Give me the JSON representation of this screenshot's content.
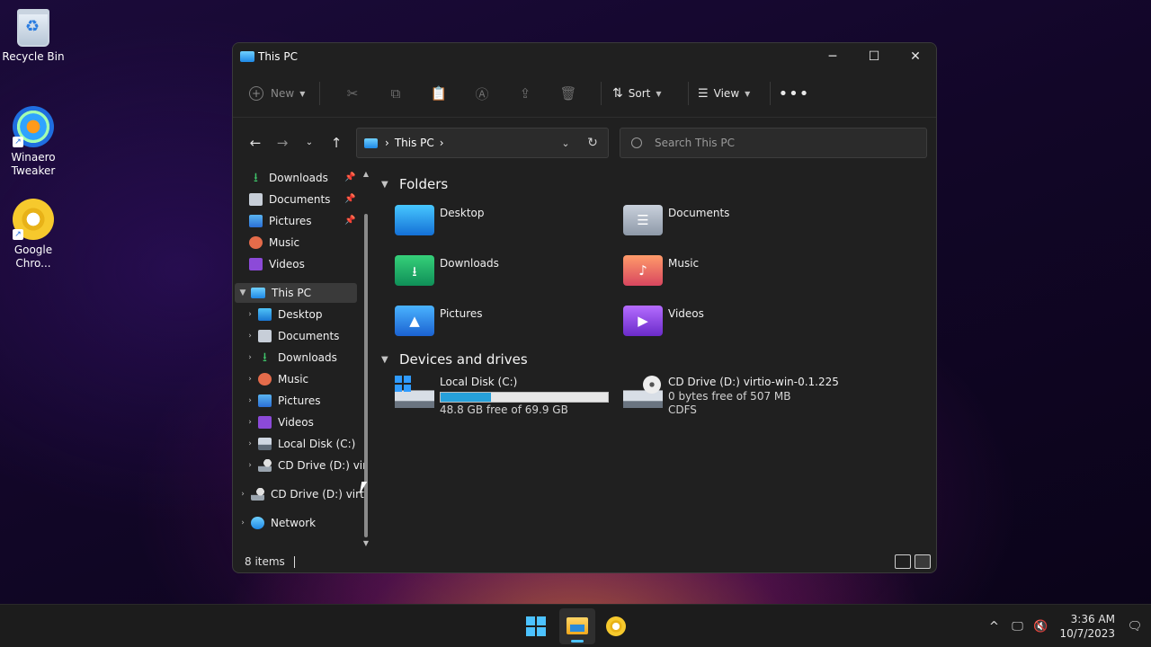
{
  "desktop": {
    "icons": [
      {
        "label": "Recycle Bin"
      },
      {
        "label": "Winaero\nTweaker"
      },
      {
        "label": "Google\nChro..."
      }
    ]
  },
  "window": {
    "title": "This PC",
    "controls": {
      "minimize": "─",
      "maximize": "☐",
      "close": "✕"
    }
  },
  "toolbar": {
    "new_label": "New",
    "sort_label": "Sort",
    "view_label": "View",
    "more_label": "•••"
  },
  "address": {
    "location": "This PC"
  },
  "search": {
    "placeholder": "Search This PC"
  },
  "sidebar": {
    "quick_access": [
      {
        "label": "Downloads",
        "icon": "download-icon"
      },
      {
        "label": "Documents",
        "icon": "documents-icon"
      },
      {
        "label": "Pictures",
        "icon": "pictures-icon"
      },
      {
        "label": "Music",
        "icon": "music-icon"
      },
      {
        "label": "Videos",
        "icon": "videos-icon"
      }
    ],
    "this_pc": "This PC",
    "this_pc_children": [
      {
        "label": "Desktop"
      },
      {
        "label": "Documents"
      },
      {
        "label": "Downloads"
      },
      {
        "label": "Music"
      },
      {
        "label": "Pictures"
      },
      {
        "label": "Videos"
      },
      {
        "label": "Local Disk (C:)"
      },
      {
        "label": "CD Drive (D:) vir"
      }
    ],
    "cd_drive": "CD Drive (D:) virti",
    "network": "Network"
  },
  "content": {
    "folders_header": "Folders",
    "folders": [
      {
        "name": "Desktop"
      },
      {
        "name": "Documents"
      },
      {
        "name": "Downloads"
      },
      {
        "name": "Music"
      },
      {
        "name": "Pictures"
      },
      {
        "name": "Videos"
      }
    ],
    "drives_header": "Devices and drives",
    "drives": [
      {
        "name": "Local Disk (C:)",
        "free": "48.8 GB free of 69.9 GB",
        "used_fraction": 0.3
      },
      {
        "name": "CD Drive (D:) virtio-win-0.1.225",
        "free": "0 bytes free of 507 MB",
        "fs": "CDFS"
      }
    ]
  },
  "status": {
    "items": "8 items"
  },
  "taskbar": {
    "time": "3:36 AM",
    "date": "10/7/2023"
  },
  "colors": {
    "accent": "#4cc2ff",
    "window_bg": "#202020",
    "drive_bar_fill": "#26a0da"
  }
}
